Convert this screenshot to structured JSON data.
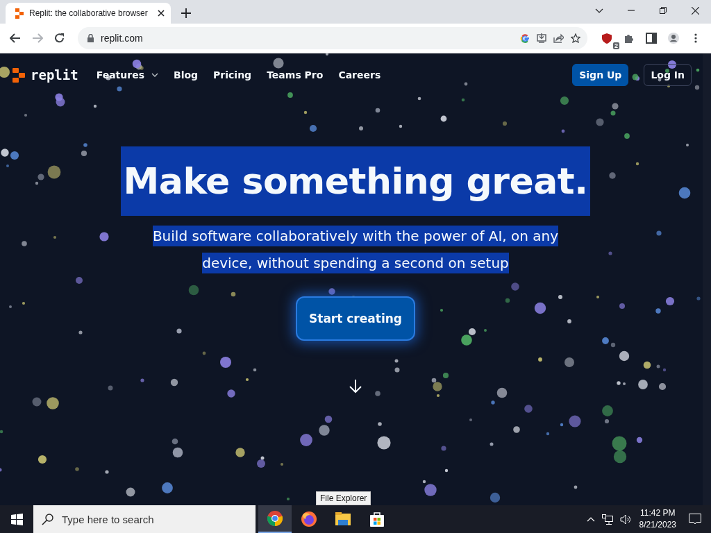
{
  "browser": {
    "tab": {
      "title": "Replit: the collaborative browser",
      "selected": true
    },
    "url": "replit.com",
    "extension_badge": "2"
  },
  "site": {
    "logo": "replit",
    "nav": [
      {
        "label": "Features",
        "has_menu": true
      },
      {
        "label": "Blog",
        "has_menu": false
      },
      {
        "label": "Pricing",
        "has_menu": false
      },
      {
        "label": "Teams Pro",
        "has_menu": false
      },
      {
        "label": "Careers",
        "has_menu": false
      }
    ],
    "actions": [
      {
        "label": "Sign Up",
        "kind": "primary"
      },
      {
        "label": "Log In",
        "kind": "outline"
      }
    ],
    "hero": {
      "title": "Make something great.",
      "subtitle": "Build software collaboratively with the power of AI, on any device, without spending a second on setup",
      "highlighted": true,
      "cta": "Start creating"
    }
  },
  "taskbar": {
    "search": {
      "placeholder": "Type here to search"
    },
    "apps": [
      {
        "kind": "chrome",
        "selected": true
      },
      {
        "kind": "firefox",
        "selected": false
      },
      {
        "kind": "explorer",
        "selected": false
      },
      {
        "kind": "store",
        "selected": false
      }
    ],
    "tooltip": "File Explorer",
    "time": "11:42 PM",
    "date": "8/21/2023"
  }
}
